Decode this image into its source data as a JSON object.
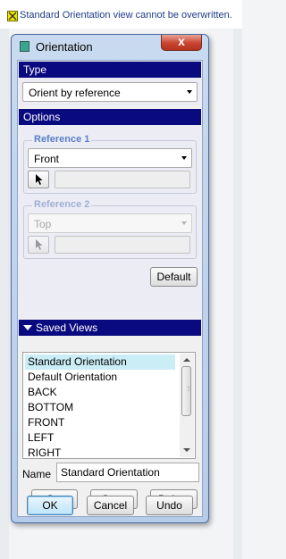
{
  "message": {
    "text": "Standard Orientation view cannot be overwritten."
  },
  "window": {
    "title": "Orientation",
    "close_label": "x"
  },
  "type_section": {
    "header": "Type",
    "selected": "Orient by reference"
  },
  "options_section": {
    "header": "Options",
    "reference1": {
      "label": "Reference 1",
      "selected": "Front",
      "selection": ""
    },
    "reference2": {
      "label": "Reference 2",
      "selected": "Top",
      "selection": ""
    },
    "default_button": "Default"
  },
  "saved_views": {
    "header": "Saved Views",
    "items": [
      "Standard Orientation",
      "Default Orientation",
      "BACK",
      "BOTTOM",
      "FRONT",
      "LEFT",
      "RIGHT"
    ],
    "selected_index": 0,
    "name_label": "Name",
    "name_value": "Standard Orientation",
    "set_button": "Set",
    "save_button": "Save",
    "delete_button": "Delete"
  },
  "footer": {
    "ok": "OK",
    "cancel": "Cancel",
    "undo": "Undo"
  },
  "colors": {
    "section_header": "#0a0a80",
    "selected_item": "#cbeef6",
    "group_label": "#5a80c8",
    "close_button": "#c9442e"
  }
}
